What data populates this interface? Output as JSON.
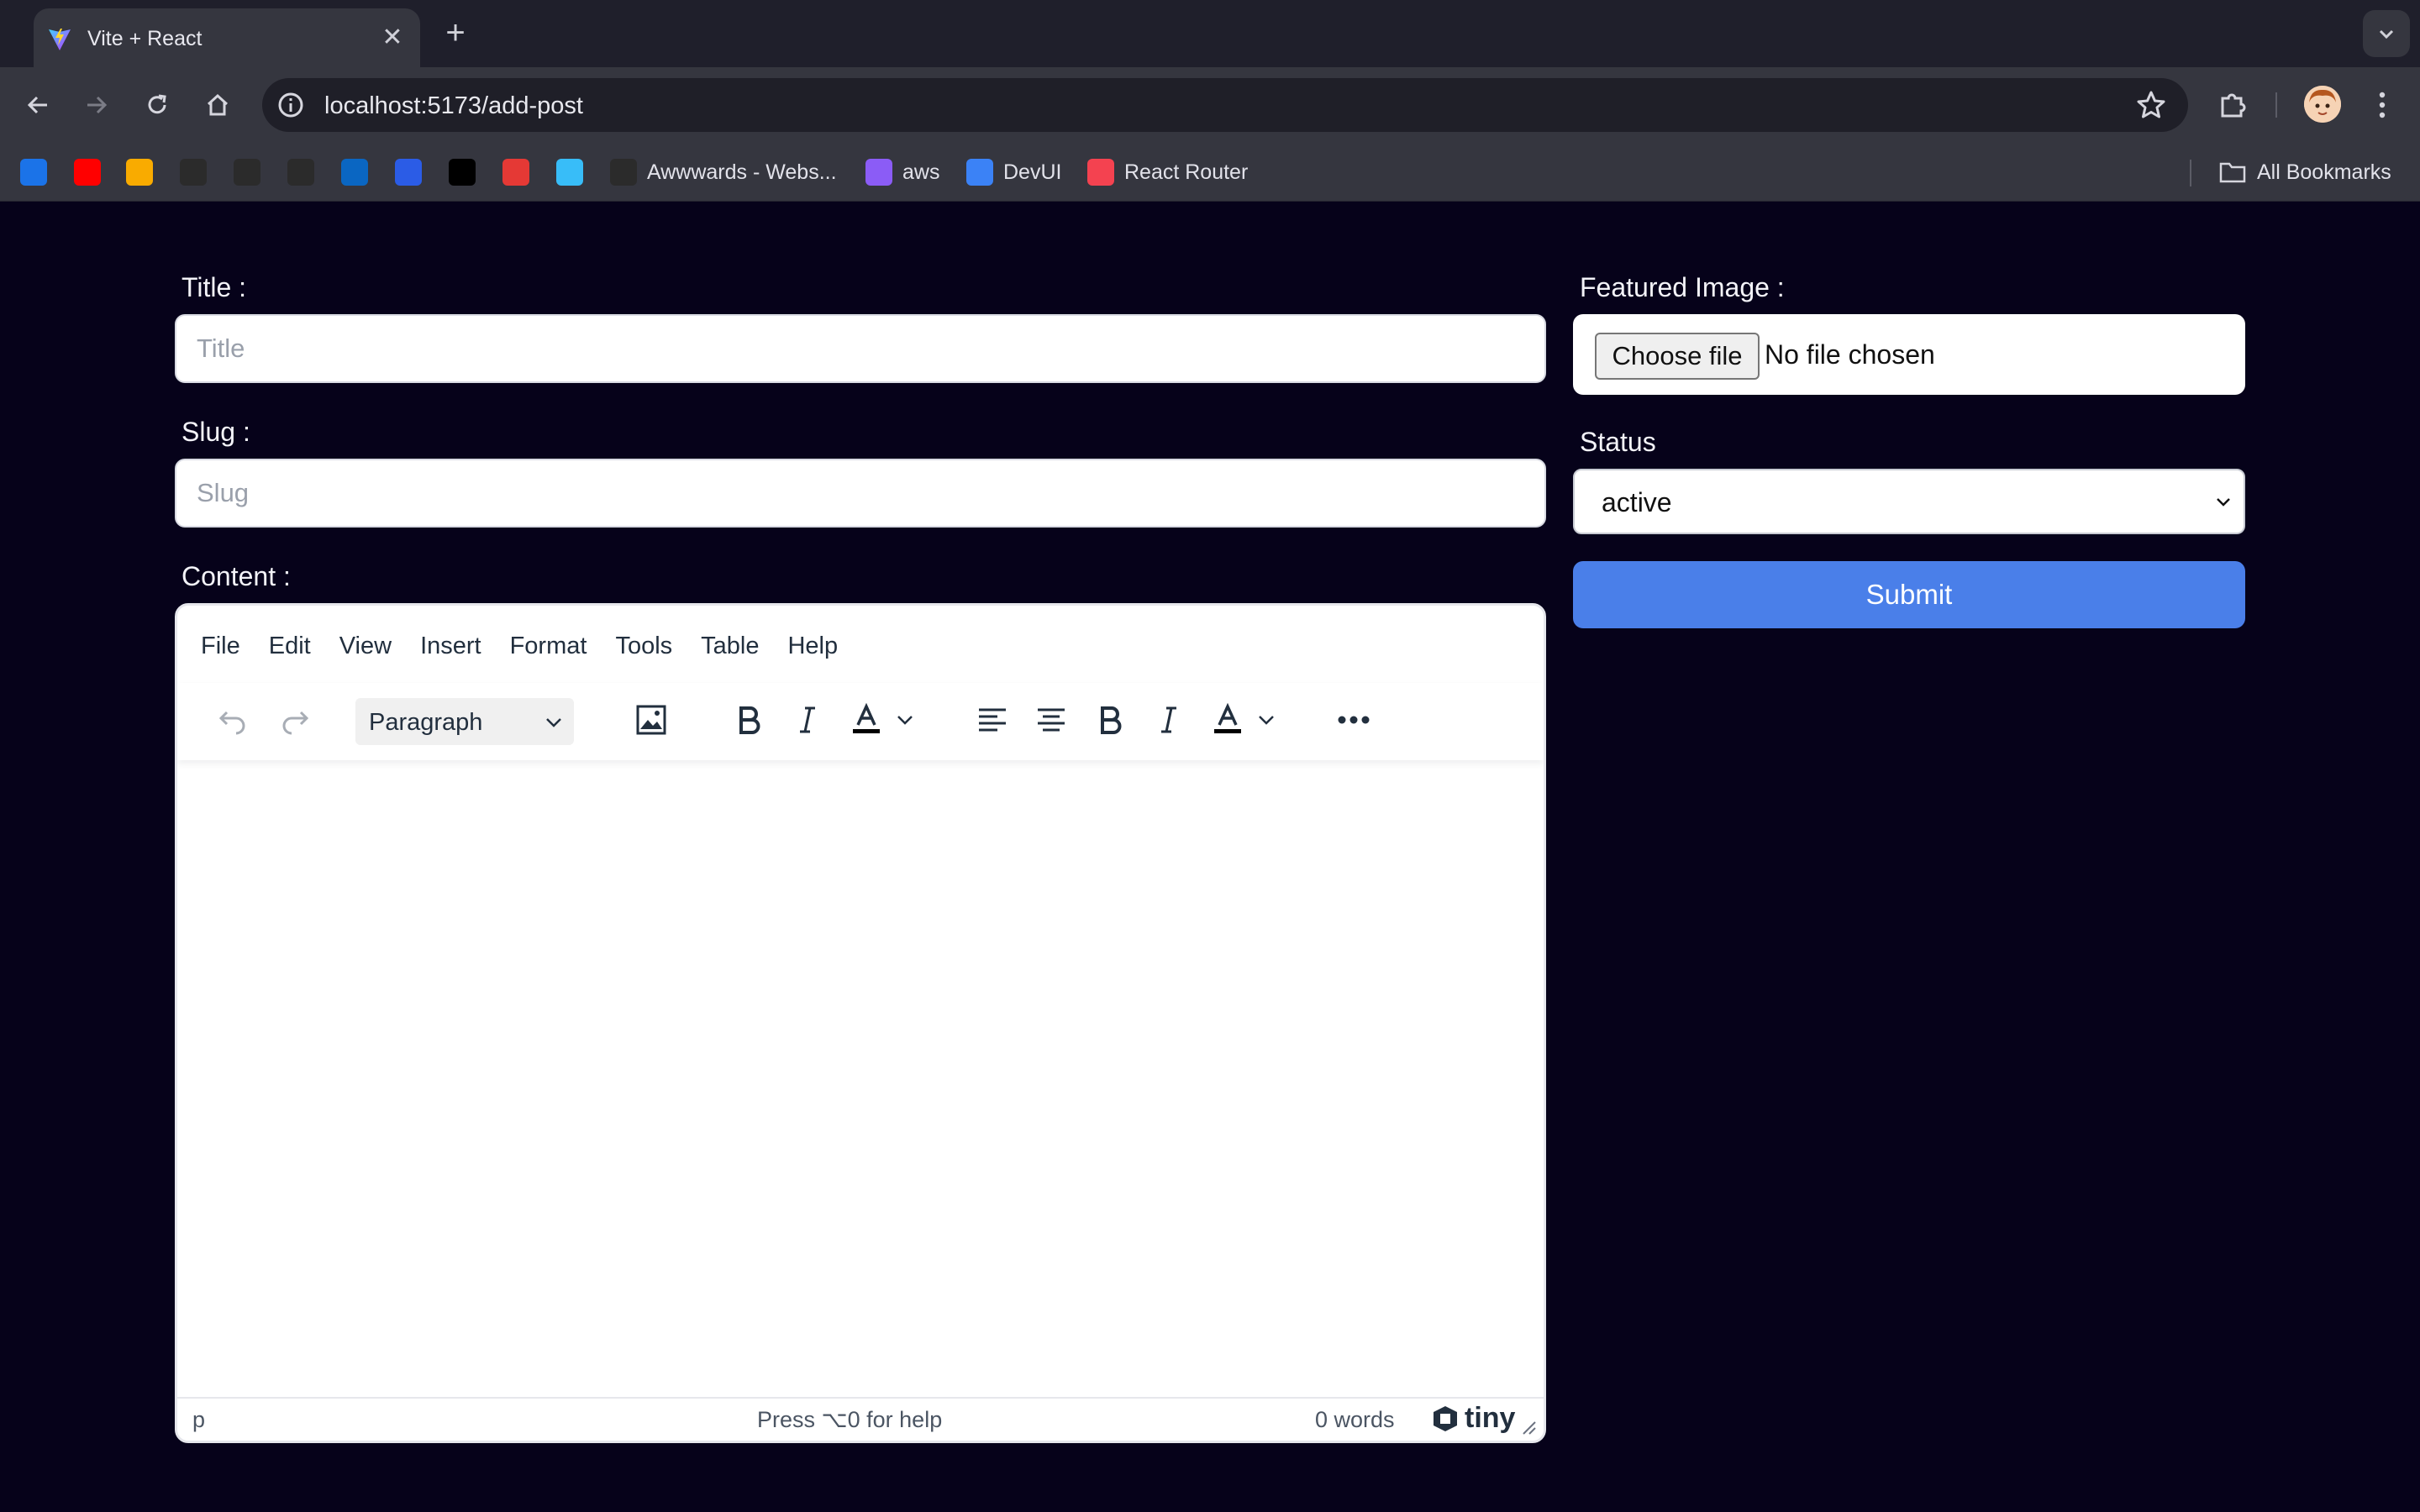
{
  "browser": {
    "tab_title": "Vite + React",
    "new_tab_symbol": "+",
    "close_symbol": "✕",
    "url": "localhost:5173/add-post",
    "bookmarks": [
      {
        "label": "",
        "icon": "play-icon",
        "color": "#1b73e8"
      },
      {
        "label": "",
        "icon": "youtube-icon",
        "color": "#ff0000"
      },
      {
        "label": "",
        "icon": "analytics-icon",
        "color": "#f9ab00"
      },
      {
        "label": "",
        "icon": "swatch-icon",
        "color": "#2b2b2b"
      },
      {
        "label": "",
        "icon": "mountain-icon",
        "color": "#2b2b2b"
      },
      {
        "label": "",
        "icon": "github-icon",
        "color": "#2b2b2b"
      },
      {
        "label": "",
        "icon": "linkedin-icon",
        "color": "#0a66c2"
      },
      {
        "label": "",
        "icon": "c-icon",
        "color": "#2b5ce6"
      },
      {
        "label": "",
        "icon": "m-icon",
        "color": "#000000"
      },
      {
        "label": "",
        "icon": "tuf-icon",
        "color": "#e53935"
      },
      {
        "label": "",
        "icon": "tailwind-icon",
        "color": "#38bdf8"
      },
      {
        "label": "Awwwards - Webs...",
        "icon": "awwwards-icon",
        "color": "#2b2b2b"
      },
      {
        "label": "aws",
        "icon": "cube-icon",
        "color": "#8b5cf6"
      },
      {
        "label": "DevUI",
        "icon": "devui-icon",
        "color": "#3b82f6"
      },
      {
        "label": "React Router",
        "icon": "react-router-icon",
        "color": "#f44250"
      }
    ],
    "all_bookmarks": "All Bookmarks"
  },
  "form": {
    "title_label": "Title :",
    "title_placeholder": "Title",
    "slug_label": "Slug :",
    "slug_placeholder": "Slug",
    "content_label": "Content :",
    "featured_label": "Featured Image :",
    "file_button": "Choose file",
    "file_status": "No file chosen",
    "status_label": "Status",
    "status_value": "active",
    "submit_label": "Submit"
  },
  "editor": {
    "menu": [
      "File",
      "Edit",
      "View",
      "Insert",
      "Format",
      "Tools",
      "Table",
      "Help"
    ],
    "block_format": "Paragraph",
    "status_path": "p",
    "help_text": "Press ⌥0 for help",
    "word_count": "0 words",
    "brand": "tiny"
  },
  "colors": {
    "page_bg": "#06021a",
    "submit_bg": "#4a7fe9",
    "chrome_bg": "#35363f"
  }
}
